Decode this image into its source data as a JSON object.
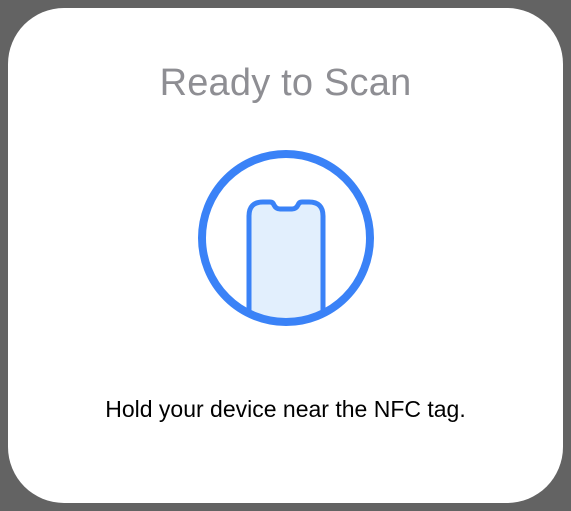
{
  "nfc_sheet": {
    "title": "Ready to Scan",
    "instruction": "Hold your device near the NFC tag.",
    "icon": "phone-in-circle-icon"
  },
  "colors": {
    "accent": "#3a82f7",
    "phone_fill": "#e2effd",
    "title": "#8e8e93",
    "instruction": "#000000",
    "backdrop": "#636363",
    "sheet": "#ffffff"
  }
}
